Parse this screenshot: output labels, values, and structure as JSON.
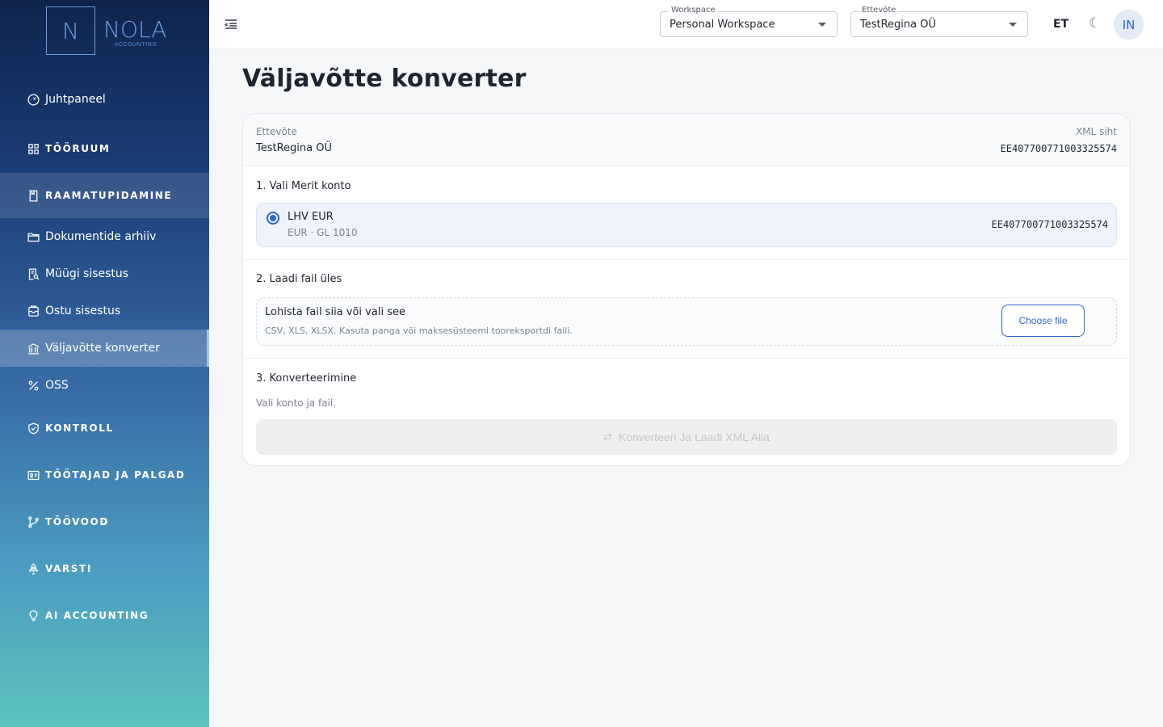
{
  "brand": {
    "letter": "N",
    "name": "NOLA",
    "sub": "ACCOUNTING"
  },
  "sidebar": {
    "items": [
      {
        "label": "Juhtpaneel",
        "icon": "dashboard-icon"
      },
      {
        "label": "TÖÖRUUM",
        "icon": "grid-icon"
      },
      {
        "label": "RAAMATUPIDAMINE",
        "icon": "book-icon"
      },
      {
        "label": "Dokumentide arhiiv",
        "icon": "folder-icon"
      },
      {
        "label": "Müügi sisestus",
        "icon": "receipt-search-icon"
      },
      {
        "label": "Ostu sisestus",
        "icon": "inbox-icon"
      },
      {
        "label": "Väljavõtte konverter",
        "icon": "bank-icon"
      },
      {
        "label": "OSS",
        "icon": "percent-icon"
      },
      {
        "label": "KONTROLL",
        "icon": "shield-check-icon"
      },
      {
        "label": "TÖÖTAJAD JA PALGAD",
        "icon": "id-card-icon"
      },
      {
        "label": "TÖÖVOOD",
        "icon": "git-branch-icon"
      },
      {
        "label": "VARSTI",
        "icon": "rocket-icon"
      },
      {
        "label": "AI ACCOUNTING",
        "icon": "lightbulb-icon"
      }
    ]
  },
  "header": {
    "workspace": {
      "legend": "Workspace",
      "value": "Personal Workspace"
    },
    "company": {
      "legend": "Ettevõte",
      "value": "TestRegina OÜ"
    },
    "language": "ET",
    "theme_icon": "☾",
    "avatar_initials": "IN"
  },
  "main": {
    "title": "Väljavõtte konverter",
    "company_label": "Ettevõte",
    "company_name": "TestRegina OÜ",
    "xml_label": "XML siht",
    "xml_target": "EE407700771003325574",
    "step1": {
      "title": "1. Vali Merit konto",
      "account_name": "LHV EUR",
      "account_meta": "EUR · GL 1010",
      "account_iban": "EE407700771003325574"
    },
    "step2": {
      "title": "2. Laadi fail üles",
      "drop_title": "Lohista fail siia või vali see",
      "drop_hint": "CSV, XLS, XLSX. Kasuta panga või maksesüsteemi tooreksportdi faili.",
      "choose_label": "Choose file"
    },
    "step3": {
      "title": "3. Konverteerimine",
      "status": "Vali konto ja fail.",
      "convert_label": "Konverteeri Ja Laadi XML Alla"
    }
  }
}
